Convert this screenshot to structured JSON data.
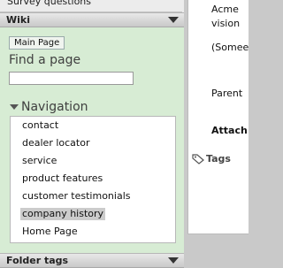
{
  "sidebar": {
    "top_item": "Survey questions",
    "wiki": {
      "title": "Wiki",
      "main_page_button": "Main Page",
      "find_label": "Find a page",
      "search_value": "",
      "navigation_title": "Navigation",
      "nav_items": [
        "contact",
        "dealer locator",
        "service",
        "product features",
        "customer testimonials",
        "company history",
        "Home Page"
      ],
      "selected_item": "company history"
    },
    "folder_tags": {
      "title": "Folder tags"
    }
  },
  "content": {
    "line1": "Acme",
    "line2": "vision",
    "line3": "(Somee",
    "line4": "Parent",
    "attachments": "Attach",
    "tags": "Tags"
  }
}
